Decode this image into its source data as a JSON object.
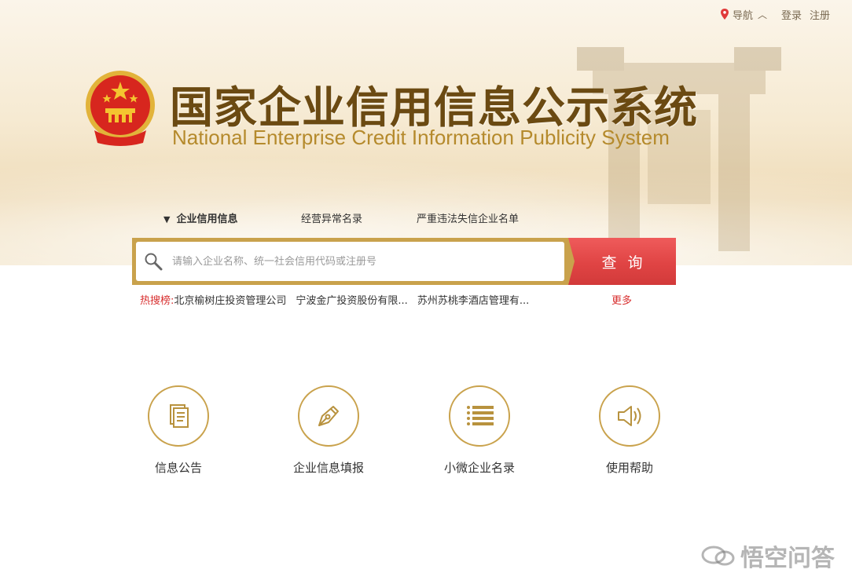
{
  "topnav": {
    "nav_label": "导航",
    "login_label": "登录",
    "register_label": "注册"
  },
  "brand": {
    "title_cn": "国家企业信用信息公示系统",
    "title_en": "National Enterprise Credit Information Publicity System"
  },
  "tabs": [
    {
      "label": "企业信用信息",
      "active": true
    },
    {
      "label": "经营异常名录",
      "active": false
    },
    {
      "label": "严重违法失信企业名单",
      "active": false
    }
  ],
  "search": {
    "placeholder": "请输入企业名称、统一社会信用代码或注册号",
    "button_label": "查询"
  },
  "hot_search": {
    "label": "热搜榜:",
    "items": [
      "北京榆树庄投资管理公司",
      "宁波金广投资股份有限...",
      "苏州苏桃李酒店管理有..."
    ],
    "more_label": "更多"
  },
  "features": [
    {
      "label": "信息公告",
      "icon": "document-icon"
    },
    {
      "label": "企业信息填报",
      "icon": "pen-icon"
    },
    {
      "label": "小微企业名录",
      "icon": "list-icon"
    },
    {
      "label": "使用帮助",
      "icon": "speaker-icon"
    }
  ],
  "watermark": {
    "text": "悟空问答"
  },
  "colors": {
    "gold": "#c9a24c",
    "brown_title": "#6b4a12",
    "red_button": "#e04444",
    "hot_red": "#d82f2f"
  }
}
